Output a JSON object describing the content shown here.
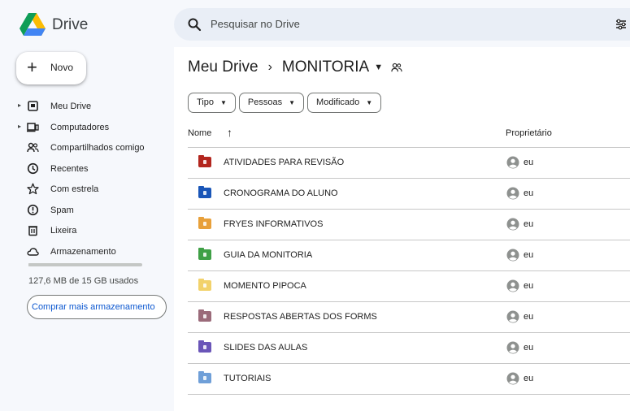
{
  "app": {
    "title": "Drive"
  },
  "search": {
    "placeholder": "Pesquisar no Drive"
  },
  "sidebar": {
    "new_label": "Novo",
    "items": [
      {
        "label": "Meu Drive",
        "icon": "my-drive-icon",
        "expandable": true
      },
      {
        "label": "Computadores",
        "icon": "computer-icon",
        "expandable": true
      },
      {
        "label": "Compartilhados comigo",
        "icon": "shared-people-icon",
        "expandable": false
      },
      {
        "label": "Recentes",
        "icon": "clock-icon",
        "expandable": false
      },
      {
        "label": "Com estrela",
        "icon": "star-icon",
        "expandable": false
      },
      {
        "label": "Spam",
        "icon": "spam-icon",
        "expandable": false
      },
      {
        "label": "Lixeira",
        "icon": "trash-icon",
        "expandable": false
      },
      {
        "label": "Armazenamento",
        "icon": "cloud-icon",
        "expandable": false
      }
    ],
    "storage_text": "127,6 MB de 15 GB usados",
    "storage_used_fraction": 0.0085,
    "buy_label": "Comprar mais armazenamento"
  },
  "breadcrumb": {
    "root": "Meu Drive",
    "separator": "›",
    "current": "MONITORIA"
  },
  "filters": [
    {
      "label": "Tipo"
    },
    {
      "label": "Pessoas"
    },
    {
      "label": "Modificado"
    }
  ],
  "table": {
    "col_name": "Nome",
    "col_owner": "Proprietário",
    "rows": [
      {
        "name": "ATIVIDADES PARA REVISÃO",
        "owner": "eu",
        "color": "#b3261e"
      },
      {
        "name": "CRONOGRAMA DO ALUNO",
        "owner": "eu",
        "color": "#1a56b8"
      },
      {
        "name": "FRYES INFORMATIVOS",
        "owner": "eu",
        "color": "#e8a03a"
      },
      {
        "name": "GUIA DA MONITORIA",
        "owner": "eu",
        "color": "#3fa046"
      },
      {
        "name": "MOMENTO PIPOCA",
        "owner": "eu",
        "color": "#f2d26b"
      },
      {
        "name": "RESPOSTAS ABERTAS DOS FORMS",
        "owner": "eu",
        "color": "#9b6b7a"
      },
      {
        "name": "SLIDES DAS AULAS",
        "owner": "eu",
        "color": "#6a55b8"
      },
      {
        "name": "TUTORIAIS",
        "owner": "eu",
        "color": "#6f9fd8"
      }
    ]
  }
}
